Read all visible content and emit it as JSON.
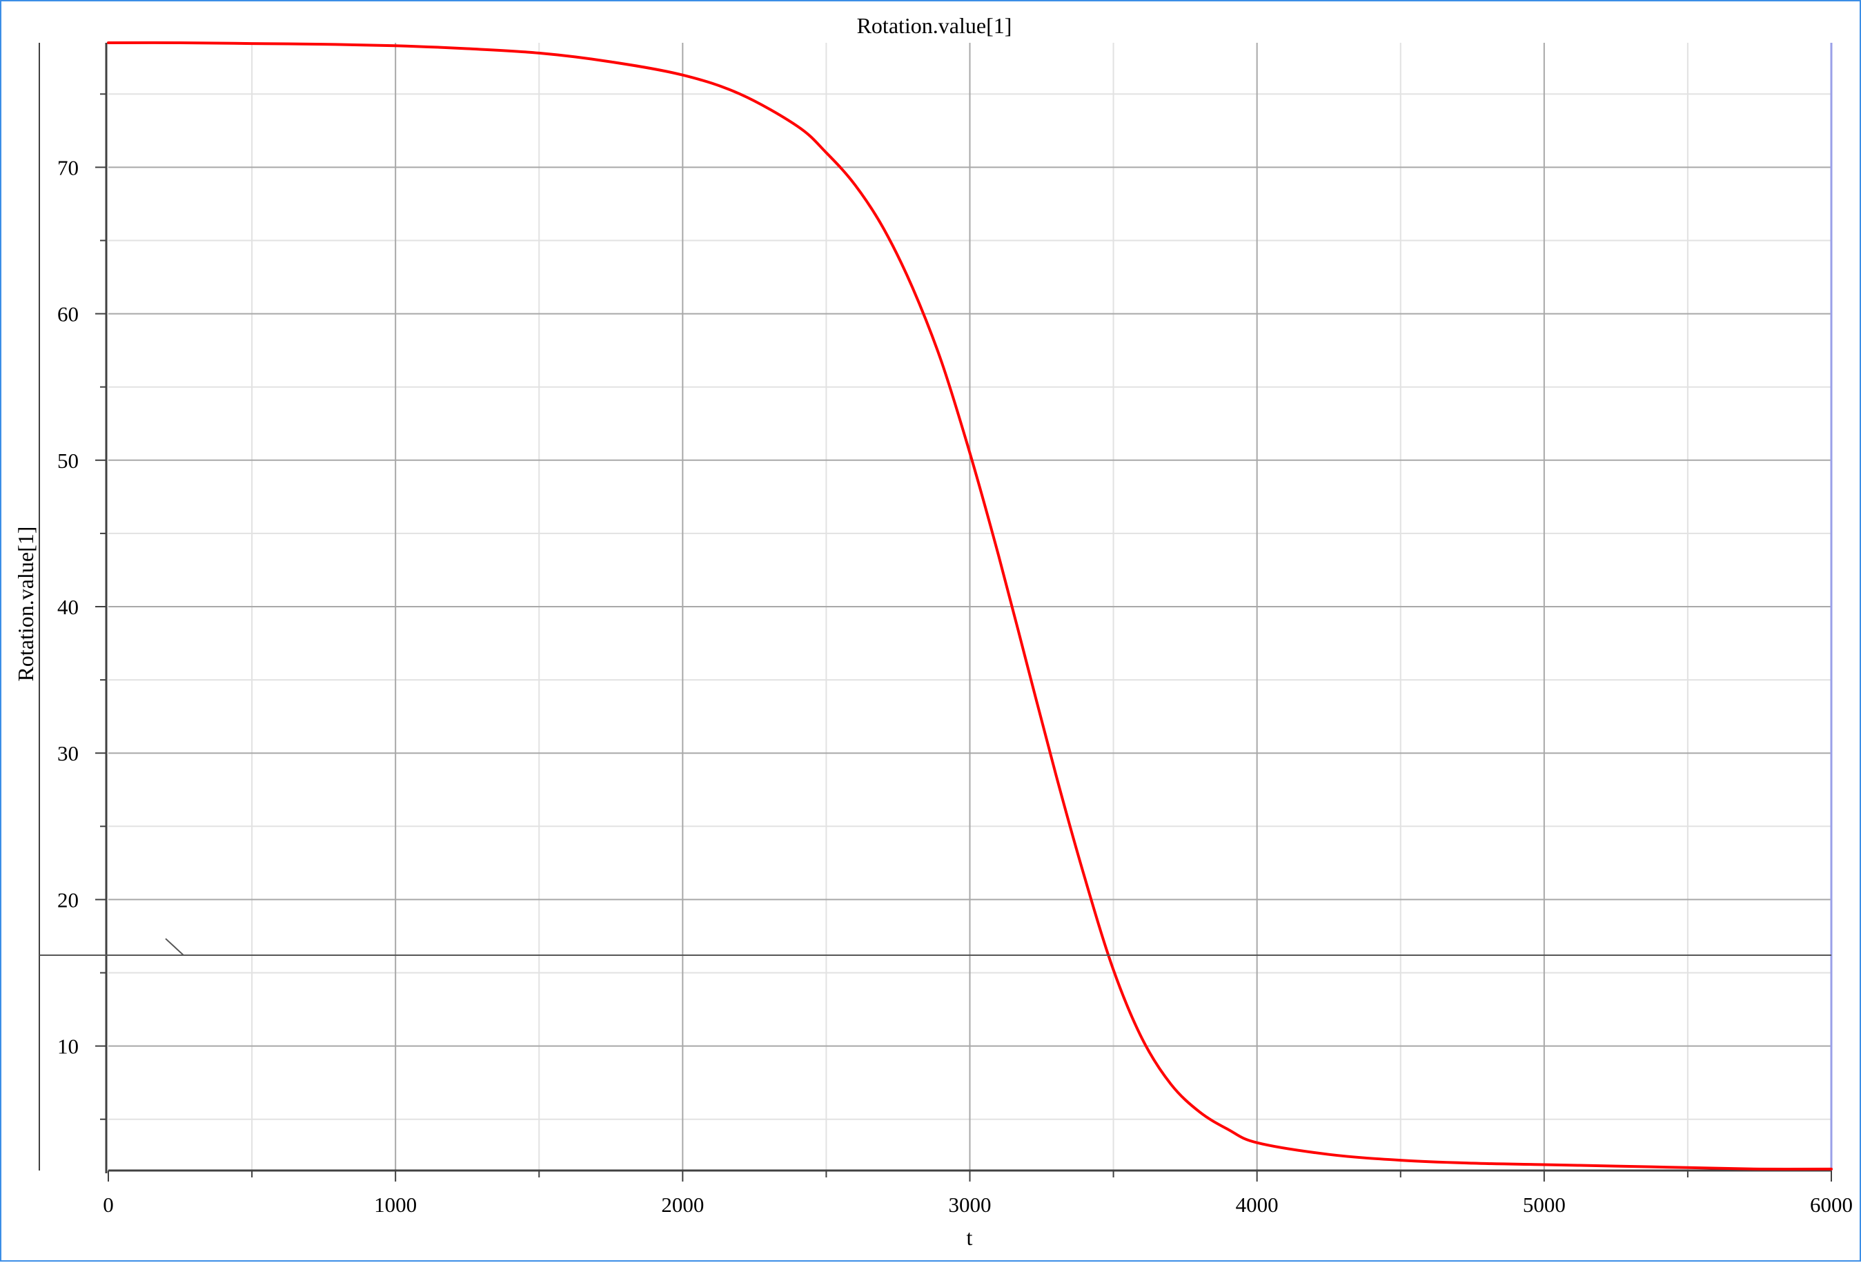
{
  "colors": {
    "frame_border": "#3c8ee6",
    "series_line": "#ff0000",
    "major_grid": "#a8a8a8",
    "minor_grid": "#e2e2e2",
    "axis": "#404040",
    "right_edge": "#9aa0e8"
  },
  "chart_data": {
    "type": "line",
    "title": "Rotation.value[1]",
    "xlabel": "t",
    "ylabel": "Rotation.value[1]",
    "xlim": [
      0,
      6000
    ],
    "ylim": [
      1.5,
      78.5
    ],
    "grid": true,
    "legend": "none",
    "x_ticks": [
      0,
      1000,
      2000,
      3000,
      4000,
      5000,
      6000
    ],
    "x_tick_labels": [
      "0",
      "1000",
      "2000",
      "3000",
      "4000",
      "5000",
      "6000"
    ],
    "y_ticks": [
      10,
      20,
      30,
      40,
      50,
      60,
      70
    ],
    "y_tick_labels": [
      "10",
      "20",
      "30",
      "40",
      "50",
      "60",
      "70"
    ],
    "crosshair_y": 16.2,
    "series": [
      {
        "color": "#ff0000",
        "x": [
          0,
          250,
          500,
          750,
          1000,
          1250,
          1500,
          1750,
          2000,
          2200,
          2400,
          2500,
          2600,
          2700,
          2800,
          2900,
          3000,
          3100,
          3200,
          3300,
          3400,
          3500,
          3600,
          3700,
          3800,
          3900,
          4000,
          4250,
          4500,
          4750,
          5000,
          5250,
          5500,
          5750,
          6000
        ],
        "y": [
          78.5,
          78.5,
          78.45,
          78.4,
          78.3,
          78.1,
          77.8,
          77.2,
          76.3,
          75.0,
          72.8,
          71.0,
          68.8,
          65.8,
          61.8,
          56.8,
          50.5,
          43.5,
          36.0,
          28.5,
          21.5,
          15.2,
          10.5,
          7.4,
          5.5,
          4.3,
          3.4,
          2.6,
          2.2,
          2.0,
          1.9,
          1.8,
          1.7,
          1.6,
          1.6
        ]
      }
    ]
  }
}
